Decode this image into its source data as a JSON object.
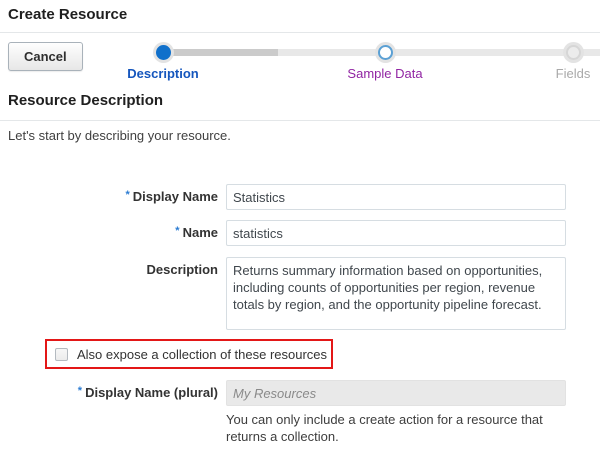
{
  "header": {
    "title": "Create Resource"
  },
  "toolbar": {
    "cancel_label": "Cancel"
  },
  "train": {
    "steps": [
      {
        "label": "Description",
        "state": "current"
      },
      {
        "label": "Sample Data",
        "state": "next"
      },
      {
        "label": "Fields",
        "state": "future"
      }
    ]
  },
  "section": {
    "title": "Resource Description",
    "intro": "Let's start by describing your resource."
  },
  "form": {
    "display_name": {
      "required_marker": "*",
      "label": "Display Name",
      "value": "Statistics"
    },
    "name": {
      "required_marker": "*",
      "label": "Name",
      "value": "statistics"
    },
    "description": {
      "label": "Description",
      "value": "Returns summary information based on opportunities, including counts of opportunities per region, revenue totals by region, and the opportunity pipeline forecast."
    },
    "collection_checkbox": {
      "label": "Also expose a collection of these resources",
      "checked": false
    },
    "display_name_plural": {
      "required_marker": "*",
      "label": "Display Name (plural)",
      "placeholder": "My Resources",
      "value": "",
      "disabled": true
    },
    "plural_help": "You can only include a create action for a resource that returns a collection."
  },
  "colors": {
    "accent_blue": "#1070cb",
    "step_current_text": "#1556bd",
    "step_next_text": "#9125a3",
    "step_future_text": "#a9a9a9",
    "annotation_red": "#e31717"
  }
}
